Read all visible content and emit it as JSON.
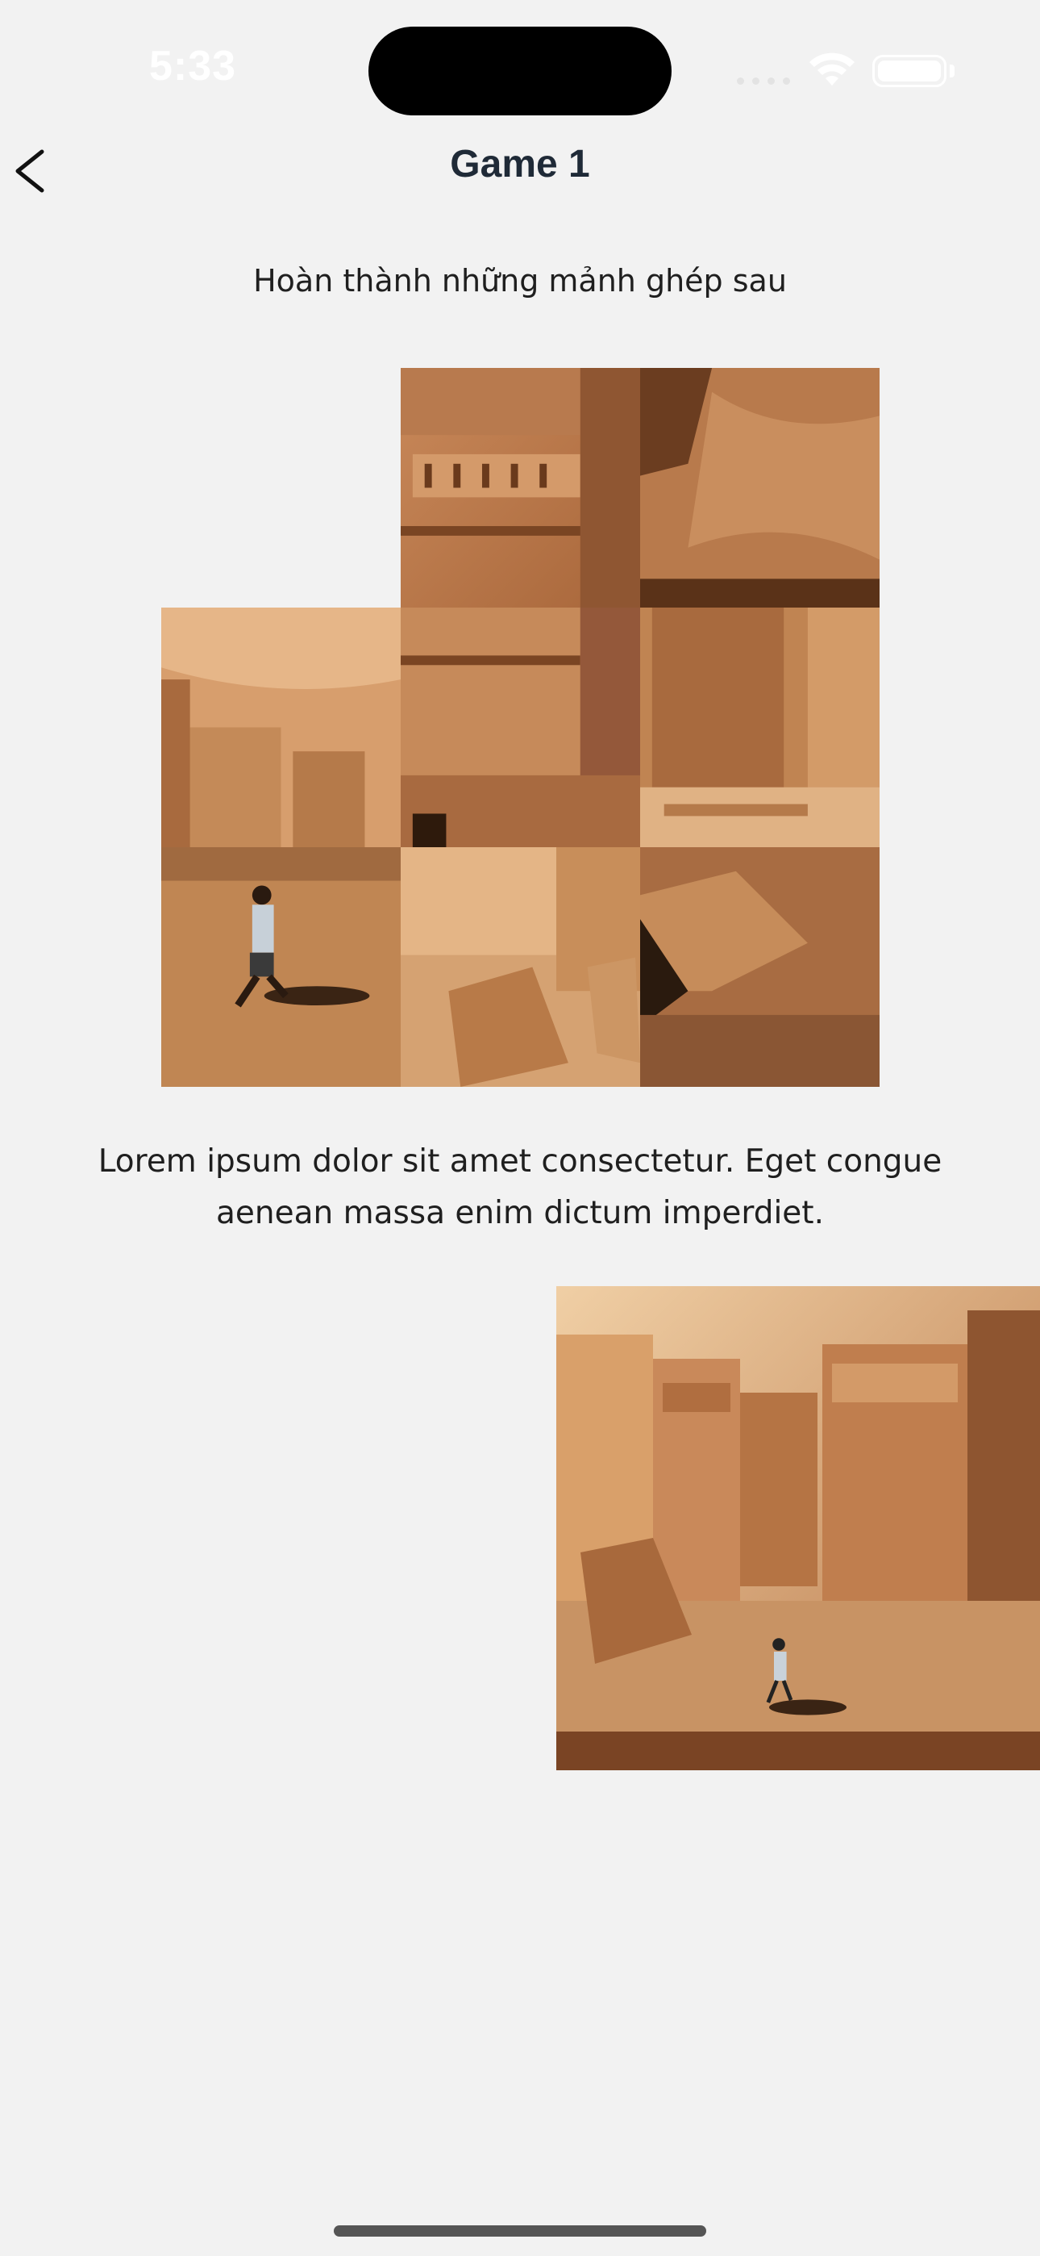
{
  "status_bar": {
    "time": "5:33"
  },
  "header": {
    "title": "Game 1",
    "back_icon": "chevron-left-icon"
  },
  "subtitle": "Hoàn thành những mảnh ghép sau",
  "puzzle": {
    "grid": "3x3",
    "empty_slot": "top-left",
    "tiles": [
      {
        "row": 0,
        "col": 1,
        "content": "carved facade upper"
      },
      {
        "row": 0,
        "col": 2,
        "content": "rock face top right"
      },
      {
        "row": 1,
        "col": 0,
        "content": "rock wall left"
      },
      {
        "row": 1,
        "col": 1,
        "content": "carved facade lower"
      },
      {
        "row": 1,
        "col": 2,
        "content": "rock block with steps"
      },
      {
        "row": 2,
        "col": 0,
        "content": "person walking"
      },
      {
        "row": 2,
        "col": 1,
        "content": "boulders"
      },
      {
        "row": 2,
        "col": 2,
        "content": "rock shadow"
      }
    ]
  },
  "description": "Lorem ipsum dolor sit amet consectetur. Eget congue aenean massa enim dictum imperdiet.",
  "reference_image": {
    "content": "desert rock tombs with person walking"
  },
  "colors": {
    "background": "#f2f2f2",
    "title": "#1f2a37",
    "sand_light": "#e0a772",
    "sand_mid": "#c98a55",
    "sand_dark": "#7a4a28"
  }
}
